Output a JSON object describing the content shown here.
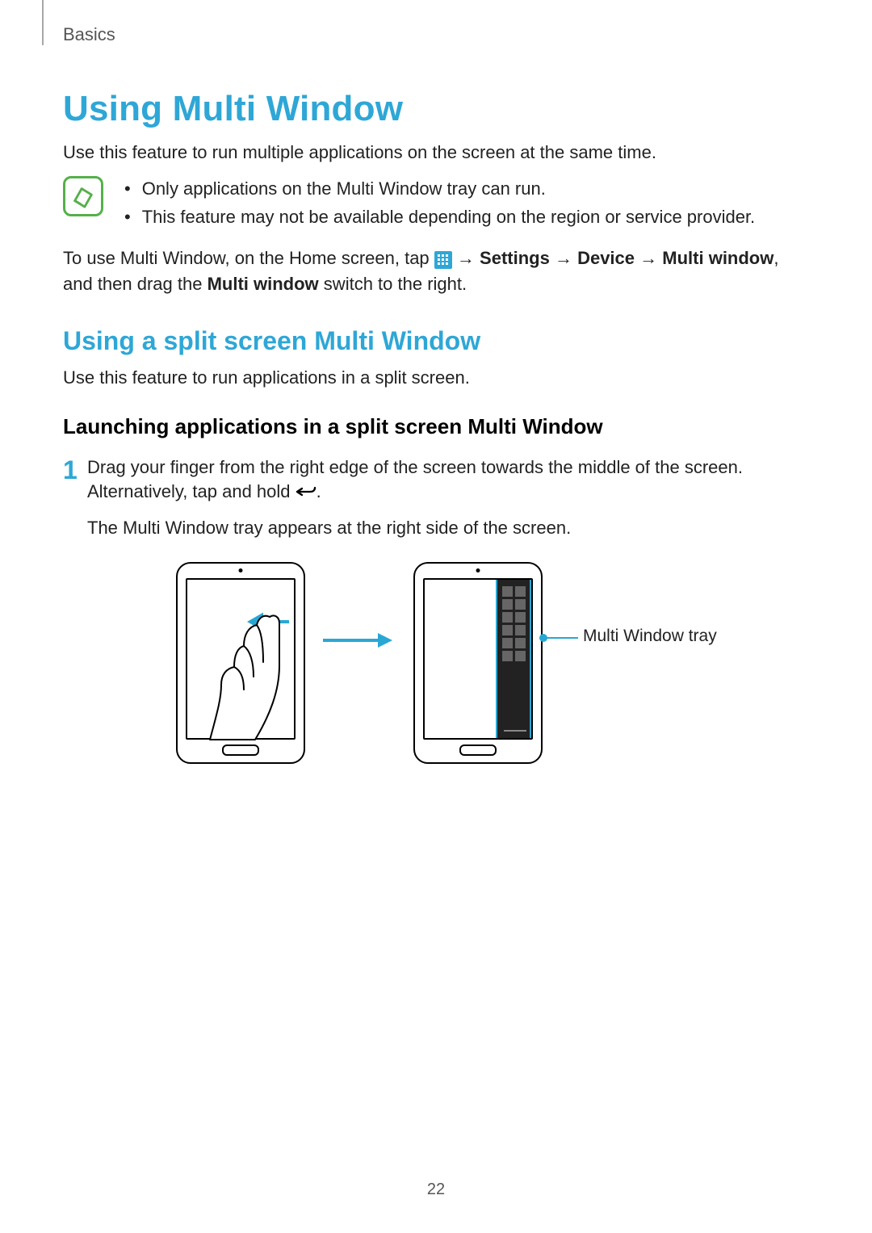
{
  "breadcrumb": "Basics",
  "title": "Using Multi Window",
  "intro": "Use this feature to run multiple applications on the screen at the same time.",
  "note": {
    "items": [
      "Only applications on the Multi Window tray can run.",
      "This feature may not be available depending on the region or service provider."
    ]
  },
  "instruction": {
    "prefix": "To use Multi Window, on the Home screen, tap ",
    "arrow": " → ",
    "settings": "Settings",
    "device": "Device",
    "multi_window": "Multi window",
    "mid": ", and then drag the ",
    "mw_bold": "Multi window",
    "suffix": " switch to the right."
  },
  "subtitle": "Using a split screen Multi Window",
  "sub_intro": "Use this feature to run applications in a split screen.",
  "section_heading": "Launching applications in a split screen Multi Window",
  "step1": {
    "num": "1",
    "line1a": "Drag your finger from the right edge of the screen towards the middle of the screen. Alternatively, tap and hold ",
    "line1b": ".",
    "result": "The Multi Window tray appears at the right side of the screen."
  },
  "callout": "Multi Window tray",
  "page_number": "22"
}
